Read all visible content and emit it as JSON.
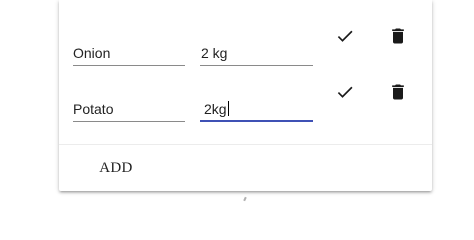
{
  "items": [
    {
      "name": "Onion",
      "quantity": "2 kg",
      "confirm_icon": "check-icon",
      "delete_icon": "trash-icon"
    },
    {
      "name": "Potato",
      "quantity": "2kg",
      "confirm_icon": "check-icon",
      "delete_icon": "trash-icon"
    }
  ],
  "actions": {
    "add_label": "ADD"
  },
  "colors": {
    "focus_underline": "#3f51b5",
    "icon": "#1a1a1a",
    "text": "#222222"
  }
}
